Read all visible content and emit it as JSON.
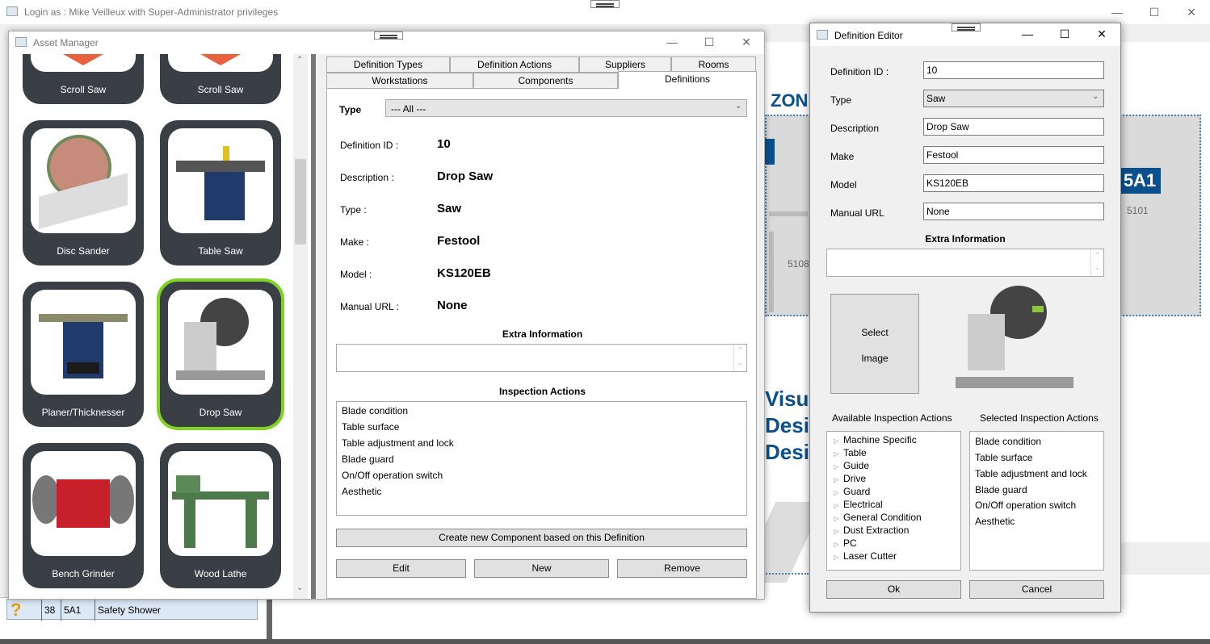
{
  "main": {
    "title": "Login as : Mike Veilleux with Super-Administrator privileges",
    "bottom_row": {
      "num": "38",
      "code": "5A1",
      "name": "Safety Shower"
    }
  },
  "background": {
    "zone_text": "ZON",
    "label_5a1": "5A1",
    "room_5101": "5101",
    "room_5108": "5108",
    "visual_lines": [
      "Visu",
      "Desi",
      "Desi"
    ]
  },
  "asset_manager": {
    "title": "Asset Manager",
    "tiles": [
      {
        "label": "Scroll Saw"
      },
      {
        "label": "Scroll Saw"
      },
      {
        "label": "Disc Sander"
      },
      {
        "label": "Table Saw"
      },
      {
        "label": "Planer/Thicknesser"
      },
      {
        "label": "Drop Saw"
      },
      {
        "label": "Bench Grinder"
      },
      {
        "label": "Wood Lathe"
      }
    ],
    "tabs_row1": [
      "Definition Types",
      "Definition Actions",
      "Suppliers",
      "Rooms"
    ],
    "tabs_row2": [
      "Workstations",
      "Components",
      "Definitions"
    ],
    "type_label": "Type",
    "type_value": "--- All ---",
    "fields": [
      {
        "label": "Definition ID :",
        "value": "10"
      },
      {
        "label": "Description :",
        "value": "Drop Saw"
      },
      {
        "label": "Type :",
        "value": "Saw"
      },
      {
        "label": "Make :",
        "value": "Festool"
      },
      {
        "label": "Model :",
        "value": "KS120EB"
      },
      {
        "label": "Manual URL :",
        "value": "None"
      }
    ],
    "extra_info_label": "Extra Information",
    "inspection_label": "Inspection Actions",
    "inspection_actions": [
      "Blade condition",
      "Table surface",
      "Table adjustment and lock",
      "Blade guard",
      "On/Off operation switch",
      "Aesthetic"
    ],
    "create_button": "Create new Component based on this Definition",
    "edit_button": "Edit",
    "new_button": "New",
    "remove_button": "Remove"
  },
  "definition_editor": {
    "title": "Definition Editor",
    "fields": [
      {
        "label": "Definition ID :",
        "value": "10"
      },
      {
        "label": "Type",
        "value": "Saw"
      },
      {
        "label": "Description",
        "value": "Drop Saw"
      },
      {
        "label": "Make",
        "value": "Festool"
      },
      {
        "label": "Model",
        "value": "KS120EB"
      },
      {
        "label": "Manual URL",
        "value": "None"
      }
    ],
    "extra_info_label": "Extra Information",
    "select_image_line1": "Select",
    "select_image_line2": "Image",
    "available_label": "Available Inspection Actions",
    "selected_label": "Selected Inspection Actions",
    "available_actions": [
      "Machine Specific",
      "Table",
      "Guide",
      "Drive",
      "Guard",
      "Electrical",
      "General Condition",
      "Dust Extraction",
      "PC",
      "Laser Cutter"
    ],
    "selected_actions": [
      "Blade condition",
      "Table surface",
      "Table adjustment and lock",
      "Blade guard",
      "On/Off operation switch",
      "Aesthetic"
    ],
    "ok_button": "Ok",
    "cancel_button": "Cancel"
  },
  "colors": {
    "selected_border": "#7ed321",
    "tile_bg": "#3a3f45",
    "accent_blue": "#0b4f8c"
  }
}
